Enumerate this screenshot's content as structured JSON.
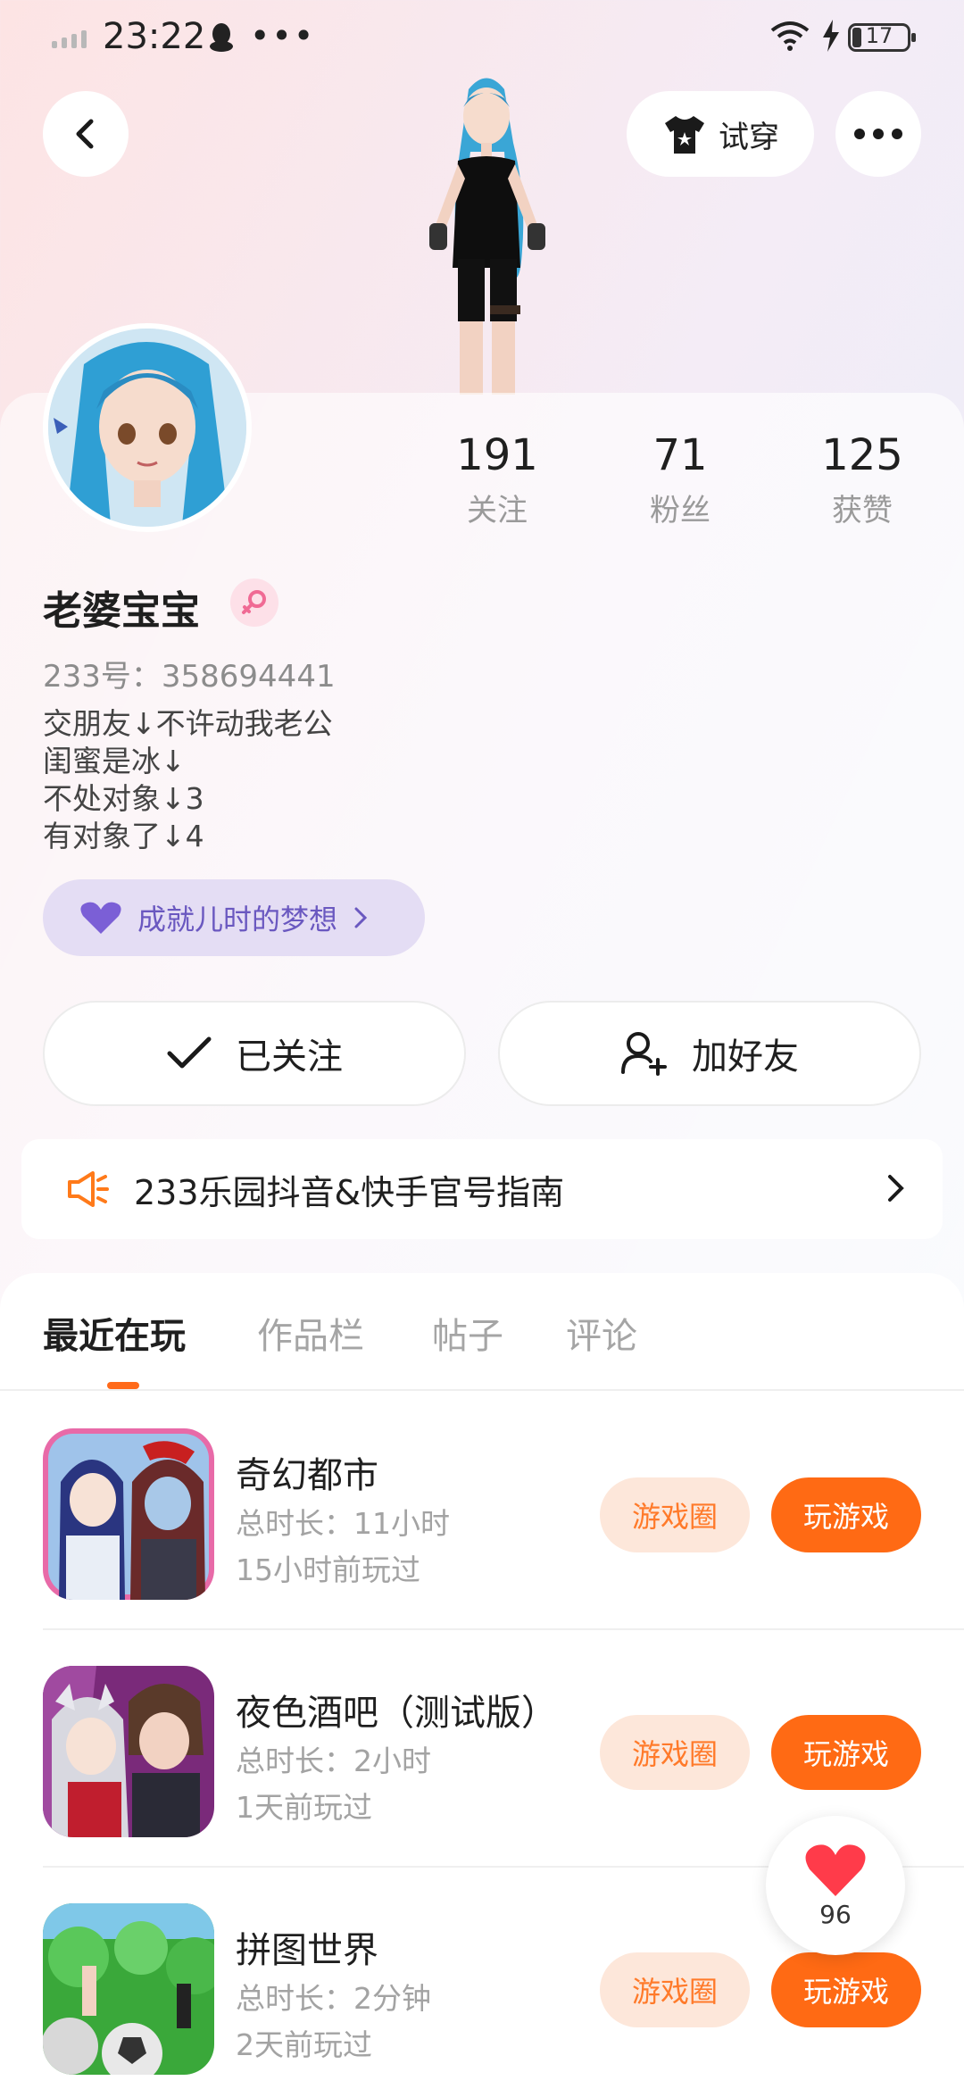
{
  "status_bar": {
    "time": "23:22",
    "battery": "17"
  },
  "header": {
    "tryon_label": "试穿"
  },
  "profile": {
    "nickname": "老婆宝宝",
    "uid": "233号：358694441",
    "bio_lines": [
      "交朋友↓不许动我老公",
      "闺蜜是冰↓",
      "不处对象↓3",
      "有对象了↓4"
    ],
    "dream_label": "成就儿时的梦想"
  },
  "stats": [
    {
      "value": "191",
      "label": "关注"
    },
    {
      "value": "71",
      "label": "粉丝"
    },
    {
      "value": "125",
      "label": "获赞"
    }
  ],
  "actions": {
    "followed_label": "已关注",
    "add_friend_label": "加好友"
  },
  "notice": {
    "text": "233乐园抖音&快手官号指南"
  },
  "tabs": [
    "最近在玩",
    "作品栏",
    "帖子",
    "评论"
  ],
  "games": [
    {
      "name": "奇幻都市",
      "duration": "总时长：11小时",
      "last_played": "15小时前玩过",
      "circle_label": "游戏圈",
      "play_label": "玩游戏"
    },
    {
      "name": "夜色酒吧（测试版）",
      "duration": "总时长：2小时",
      "last_played": "1天前玩过",
      "circle_label": "游戏圈",
      "play_label": "玩游戏"
    },
    {
      "name": "拼图世界",
      "duration": "总时长：2分钟",
      "last_played": "2天前玩过",
      "circle_label": "游戏圈",
      "play_label": "玩游戏"
    }
  ],
  "floating_like": {
    "count": "96"
  },
  "colors": {
    "accent": "#ff6a14",
    "accent_light": "#fde7da",
    "dream_purple": "#6a58c0"
  }
}
